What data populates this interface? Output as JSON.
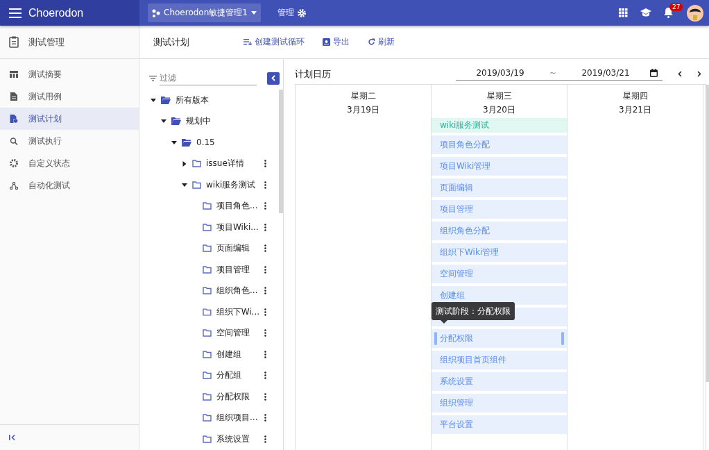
{
  "header": {
    "brand": "Choerodon",
    "project": "Choerodon敏捷管理1",
    "manage": "管理",
    "notifications": "27"
  },
  "sidebar": {
    "title": "测试管理",
    "items": [
      {
        "label": "测试摘要",
        "selected": false
      },
      {
        "label": "测试用例",
        "selected": false
      },
      {
        "label": "测试计划",
        "selected": true
      },
      {
        "label": "测试执行",
        "selected": false
      },
      {
        "label": "自定义状态",
        "selected": false
      },
      {
        "label": "自动化测试",
        "selected": false
      }
    ]
  },
  "toolbar": {
    "title": "测试计划",
    "actions": [
      {
        "label": "创建测试循环"
      },
      {
        "label": "导出"
      },
      {
        "label": "刷新"
      }
    ]
  },
  "tree": {
    "filter_placeholder": "过滤",
    "nodes": [
      {
        "label": "所有版本",
        "kind": "version",
        "expanded": true,
        "children": [
          {
            "label": "规划中",
            "kind": "version",
            "expanded": true,
            "children": [
              {
                "label": "0.15",
                "kind": "version",
                "expanded": true,
                "children": [
                  {
                    "label": "issue详情",
                    "kind": "cycle",
                    "expanded": false
                  },
                  {
                    "label": "wiki服务测试",
                    "kind": "cycle",
                    "expanded": true,
                    "children": [
                      {
                        "label": "项目角色...",
                        "kind": "cycle"
                      },
                      {
                        "label": "项目Wiki...",
                        "kind": "cycle"
                      },
                      {
                        "label": "页面编辑",
                        "kind": "cycle"
                      },
                      {
                        "label": "项目管理",
                        "kind": "cycle"
                      },
                      {
                        "label": "组织角色...",
                        "kind": "cycle"
                      },
                      {
                        "label": "组织下Wi...",
                        "kind": "cycle"
                      },
                      {
                        "label": "空间管理",
                        "kind": "cycle"
                      },
                      {
                        "label": "创建组",
                        "kind": "cycle"
                      },
                      {
                        "label": "分配组",
                        "kind": "cycle"
                      },
                      {
                        "label": "分配权限",
                        "kind": "cycle"
                      },
                      {
                        "label": "组织项目...",
                        "kind": "cycle"
                      },
                      {
                        "label": "系统设置",
                        "kind": "cycle"
                      }
                    ]
                  }
                ]
              }
            ]
          }
        ]
      }
    ]
  },
  "calendar": {
    "title": "计划日历",
    "start": "2019/03/19",
    "separator": "~",
    "end": "2019/03/21",
    "days": [
      {
        "weekday": "星期二",
        "date": "3月19日"
      },
      {
        "weekday": "星期三",
        "date": "3月20日",
        "events": [
          {
            "label": "wiki服务测试",
            "kind": "cycle",
            "selected": false
          },
          {
            "label": "项目角色分配",
            "kind": "phase",
            "selected": false
          },
          {
            "label": "项目Wiki管理",
            "kind": "phase",
            "selected": false
          },
          {
            "label": "页面编辑",
            "kind": "phase",
            "selected": false
          },
          {
            "label": "项目管理",
            "kind": "phase",
            "selected": false
          },
          {
            "label": "组织角色分配",
            "kind": "phase",
            "selected": false
          },
          {
            "label": "组织下Wiki管理",
            "kind": "phase",
            "selected": false
          },
          {
            "label": "空间管理",
            "kind": "phase",
            "selected": false
          },
          {
            "label": "创建组",
            "kind": "phase",
            "selected": false
          },
          {
            "kind": "phase",
            "selected": false
          },
          {
            "label": "分配权限",
            "kind": "phase",
            "selected": true
          },
          {
            "label": "组织项目首页组件",
            "kind": "phase",
            "selected": false
          },
          {
            "label": "系统设置",
            "kind": "phase",
            "selected": false
          },
          {
            "label": "组织管理",
            "kind": "phase",
            "selected": false
          },
          {
            "label": "平台设置",
            "kind": "phase",
            "selected": false
          }
        ]
      },
      {
        "weekday": "星期四",
        "date": "3月21日"
      }
    ],
    "tooltip": "测试阶段：分配权限"
  }
}
